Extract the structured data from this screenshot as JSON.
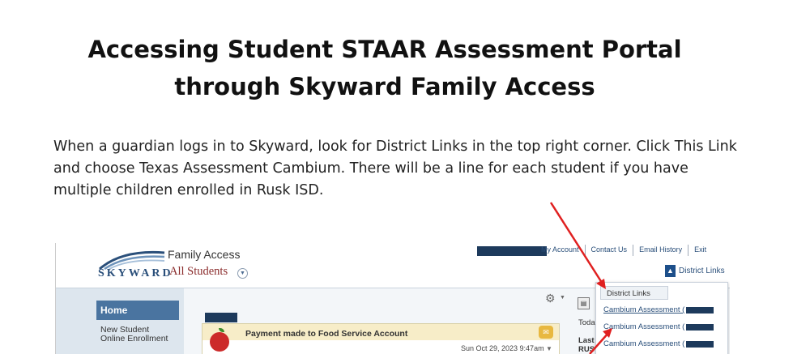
{
  "document": {
    "title_line1": "Accessing Student STAAR Assessment Portal",
    "title_line2": "through Skyward Family Access",
    "body": "When a guardian logs in to Skyward, look for District Links in the top right corner. Click This Link and choose Texas Assessment Cambium. There will be a line for each student if you have multiple children enrolled in Rusk ISD."
  },
  "skyward": {
    "logo_text": "SKYWARD",
    "app_title": "Family Access",
    "student_selector": "All Students",
    "top_links": [
      "My Account",
      "Contact Us",
      "Email History",
      "Exit"
    ],
    "district_links_label": "District Links",
    "sidebar": {
      "home": "Home",
      "item1": "New Student Online Enrollment"
    },
    "message": {
      "title": "Payment made to Food Service Account",
      "timestamp": "Sun Oct 29, 2023 9:47am"
    },
    "right_col": {
      "today": "Toda",
      "last": "Last RUS"
    },
    "district_links_menu": {
      "header": "District Links",
      "items": [
        "Cambium Assessment (",
        "Cambium Assessment (",
        "Cambium Assessment ("
      ]
    }
  },
  "colors": {
    "redaction": "#1d3a5c",
    "annotation_arrow": "#e02020",
    "home_button": "#4a74a0"
  }
}
